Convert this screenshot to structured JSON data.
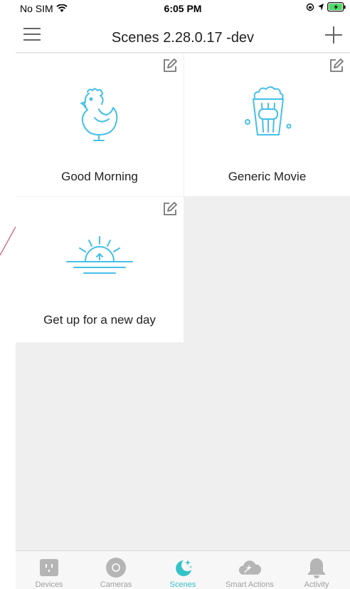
{
  "status_bar": {
    "carrier": "No SIM",
    "time": "6:05 PM"
  },
  "header": {
    "title": "Scenes 2.28.0.17 -dev"
  },
  "scenes": [
    {
      "label": "Good Morning",
      "icon": "rooster-icon"
    },
    {
      "label": "Generic Movie",
      "icon": "popcorn-icon"
    },
    {
      "label": "Get up for a new day",
      "icon": "sunrise-icon"
    }
  ],
  "tabs": [
    {
      "label": "Devices",
      "icon": "plug-icon",
      "active": false
    },
    {
      "label": "Cameras",
      "icon": "camera-icon",
      "active": false
    },
    {
      "label": "Scenes",
      "icon": "scenes-icon",
      "active": true
    },
    {
      "label": "Smart Actions",
      "icon": "smart-actions-icon",
      "active": false
    },
    {
      "label": "Activity",
      "icon": "bell-icon",
      "active": false
    }
  ],
  "colors": {
    "accent": "#34c3c8",
    "tab_inactive": "#a0a0a0",
    "background": "#efefef"
  }
}
